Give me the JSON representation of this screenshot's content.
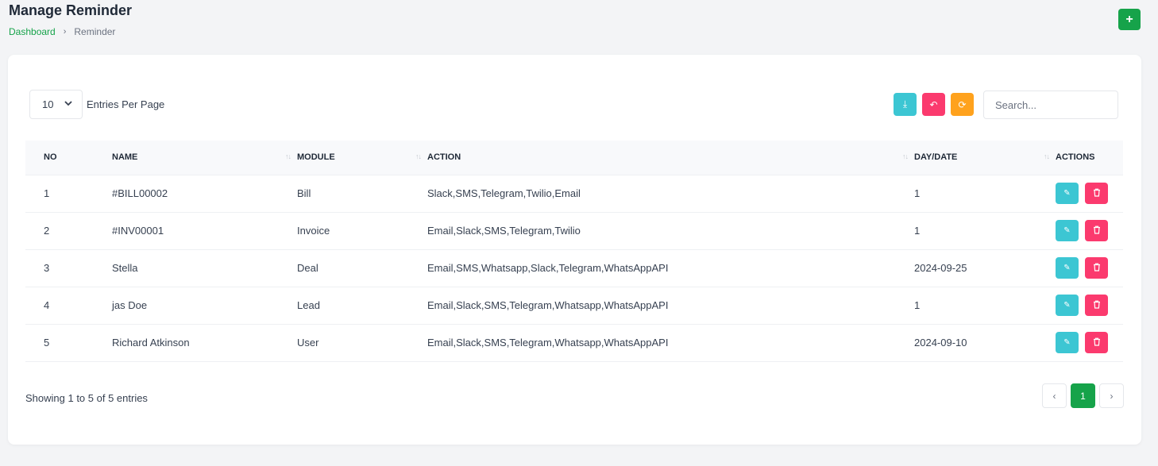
{
  "header": {
    "title": "Manage Reminder",
    "breadcrumb": {
      "home": "Dashboard",
      "separator": "›",
      "current": "Reminder"
    },
    "add_icon": "+"
  },
  "toolbar": {
    "per_page_value": "10",
    "per_page_chevron": "⌄",
    "entries_label": "Entries Per Page",
    "export_icon": "⤓",
    "reset_icon": "↶",
    "refresh_icon": "⟳",
    "search_placeholder": "Search..."
  },
  "table": {
    "headers": [
      "NO",
      "NAME",
      "MODULE",
      "ACTION",
      "DAY/DATE",
      "ACTIONS"
    ],
    "sort_icon": "↑↓",
    "rows": [
      {
        "no": "1",
        "name": "#BILL00002",
        "module": "Bill",
        "action": "Slack,SMS,Telegram,Twilio,Email",
        "date": "1"
      },
      {
        "no": "2",
        "name": "#INV00001",
        "module": "Invoice",
        "action": "Email,Slack,SMS,Telegram,Twilio",
        "date": "1"
      },
      {
        "no": "3",
        "name": "Stella",
        "module": "Deal",
        "action": "Email,SMS,Whatsapp,Slack,Telegram,WhatsAppAPI",
        "date": "2024-09-25"
      },
      {
        "no": "4",
        "name": "jas Doe",
        "module": "Lead",
        "action": "Email,Slack,SMS,Telegram,Whatsapp,WhatsAppAPI",
        "date": "1"
      },
      {
        "no": "5",
        "name": "Richard Atkinson",
        "module": "User",
        "action": "Email,Slack,SMS,Telegram,Whatsapp,WhatsAppAPI",
        "date": "2024-09-10"
      }
    ],
    "edit_icon": "✎",
    "delete_icon": "🗑"
  },
  "footer": {
    "info": "Showing 1 to 5 of 5 entries",
    "prev": "‹",
    "page": "1",
    "next": "›"
  },
  "colors": {
    "primary": "#16a34a",
    "info": "#3cc6d3",
    "danger": "#fb3a6e",
    "warning": "#ffa21d"
  }
}
